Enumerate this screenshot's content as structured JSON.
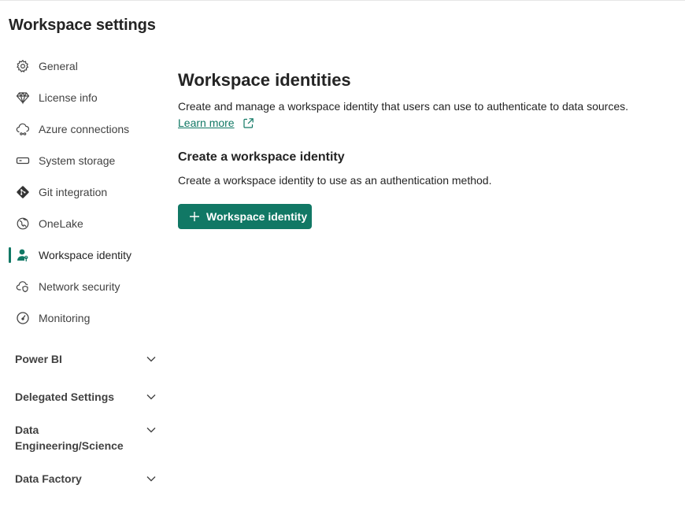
{
  "page": {
    "title": "Workspace settings"
  },
  "nav": {
    "items": [
      {
        "label": "General",
        "icon": "gear-icon"
      },
      {
        "label": "License info",
        "icon": "diamond-icon"
      },
      {
        "label": "Azure connections",
        "icon": "cloud-link-icon"
      },
      {
        "label": "System storage",
        "icon": "storage-icon"
      },
      {
        "label": "Git integration",
        "icon": "git-icon"
      },
      {
        "label": "OneLake",
        "icon": "onelake-icon"
      },
      {
        "label": "Workspace identity",
        "icon": "person-key-icon",
        "active": true
      },
      {
        "label": "Network security",
        "icon": "cloud-shield-icon"
      },
      {
        "label": "Monitoring",
        "icon": "gauge-icon"
      }
    ]
  },
  "sections": [
    {
      "label": "Power BI"
    },
    {
      "label": "Delegated Settings"
    },
    {
      "label": "Data Engineering/Science"
    },
    {
      "label": "Data Factory"
    }
  ],
  "main": {
    "title": "Workspace identities",
    "description": "Create and manage a workspace identity that users can use to authenticate to data sources.",
    "learn_more": "Learn more",
    "subtitle": "Create a workspace identity",
    "sub_description": "Create a workspace identity to use as an authentication method.",
    "button_label": "Workspace identity"
  },
  "colors": {
    "accent": "#117865",
    "text": "#242424",
    "muted": "#424242"
  }
}
